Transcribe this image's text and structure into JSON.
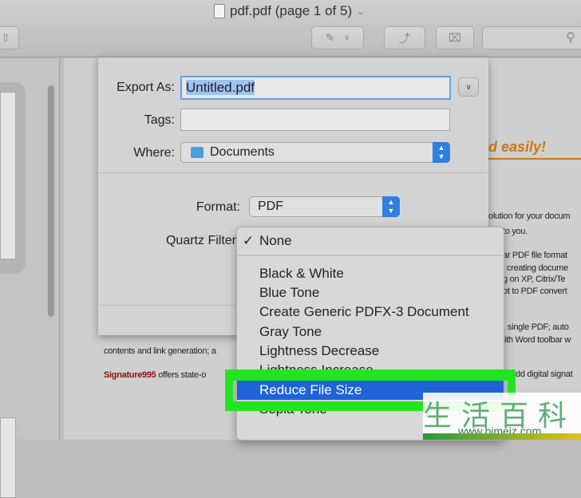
{
  "window": {
    "title": "pdf.pdf (page 1 of 5)"
  },
  "toolbar": {
    "search_icon": "magnifier-icon",
    "markup_icon": "pen-icon",
    "rotate_icon": "rotate-icon",
    "toolbox_icon": "toolbox-icon",
    "share_icon": "share-icon"
  },
  "document": {
    "heading": "d easily!",
    "lines": [
      "olution for your docum",
      "to you.",
      "ar PDF file format",
      "creating docume",
      "g on XP, Citrix/Te",
      "ot to PDF convert",
      "single PDF; auto",
      "ith Word toolbar w",
      "contents and link generation; a",
      "dd digital signat"
    ],
    "signature_brand": "Signature995",
    "signature_text": " offers state-o"
  },
  "dialog": {
    "export_as_label": "Export As:",
    "export_as_value": "Untitled.pdf",
    "tags_label": "Tags:",
    "tags_value": "",
    "where_label": "Where:",
    "where_value": "Documents",
    "format_label": "Format:",
    "format_value": "PDF",
    "quartz_label": "Quartz Filter"
  },
  "menu": {
    "checked": "None",
    "items": [
      "Black & White",
      "Blue Tone",
      "Create Generic PDFX-3 Document",
      "Gray Tone",
      "Lightness Decrease",
      "Lightness Increase",
      "Reduce File Size",
      "Sepia Tone"
    ],
    "highlighted": "Reduce File Size"
  },
  "watermark": {
    "chars": "生活百科",
    "url": "www.bimeiz.com"
  },
  "colors": {
    "accent": "#1f63d8",
    "highlight_box": "#22e422",
    "heading": "#c87a14",
    "brand": "#8b1010"
  }
}
